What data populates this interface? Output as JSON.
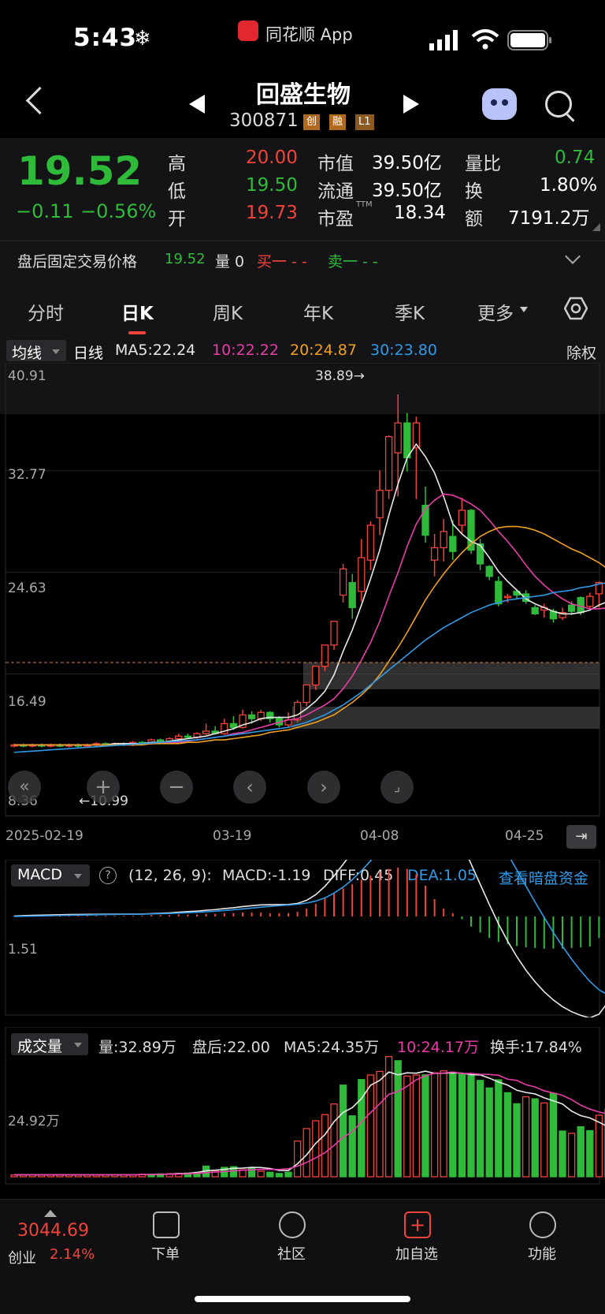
{
  "status_bar": {
    "time": "5:43",
    "app_name": "同花顺 App"
  },
  "header": {
    "stock_name": "回盛生物",
    "stock_code": "300871",
    "tags": [
      "创",
      "融",
      "L1"
    ]
  },
  "quote": {
    "price": "19.52",
    "change": "−0.11",
    "change_pct": "−0.56%",
    "high_label": "高",
    "high": "20.00",
    "low_label": "低",
    "low": "19.50",
    "open_label": "开",
    "open": "19.73",
    "mktcap_label": "市值",
    "mktcap": "39.50亿",
    "float_label": "流通",
    "float": "39.50亿",
    "pe_label": "市盈",
    "pe_sup": "TTM",
    "pe": "18.34",
    "vol_ratio_label": "量比",
    "vol_ratio": "0.74",
    "turnover_label": "换",
    "turnover": "1.80%",
    "amount_label": "额",
    "amount": "7191.2万"
  },
  "after_hours": {
    "label": "盘后固定交易价格",
    "price": "19.52",
    "vol": "量 0",
    "buy": "买一 - -",
    "sell": "卖一 - -"
  },
  "tabs": [
    "分时",
    "日K",
    "周K",
    "年K",
    "季K",
    "更多"
  ],
  "active_tab": "日K",
  "ma_bar": {
    "dropdown": "均线",
    "period": "日线",
    "ma5": "MA5:22.24",
    "ma10": "10:22.22",
    "ma20": "20:24.87",
    "ma30": "30:23.80",
    "fq": "除权"
  },
  "kline": {
    "y_ticks": [
      "40.91",
      "32.77",
      "24.63",
      "16.49",
      "8.36"
    ],
    "max_label": "38.89→",
    "min_label": "←10.99",
    "dates": [
      "2025-02-19",
      "03-19",
      "04-08",
      "04-25"
    ]
  },
  "macd": {
    "dropdown": "MACD",
    "params": "(12, 26, 9):",
    "macd": "MACD:-1.19",
    "diff": "DIFF:0.45",
    "dea": "DEA:1.05",
    "link": "查看暗盘资金",
    "tick": "1.51"
  },
  "volume": {
    "dropdown": "成交量",
    "vol": "量:32.89万",
    "after": "盘后:22.00",
    "ma5": "MA5:24.35万",
    "ma10": "10:24.17万",
    "turnover": "换手:17.84%",
    "tick": "24.92万"
  },
  "bottom": {
    "index_value": "3044.69",
    "index_name": "创业",
    "index_pct": "2.14%",
    "nav": [
      "下单",
      "社区",
      "加自选",
      "功能"
    ]
  },
  "colors": {
    "up": "#f0443a",
    "down": "#2fba3a",
    "ma5": "#e8e8e8",
    "ma10": "#e83ca8",
    "ma20": "#f0a020",
    "ma30": "#2f9ae8"
  },
  "chart_data": {
    "type": "candlestick",
    "ylim": [
      8.36,
      40.91
    ],
    "candles": [
      {
        "o": 10.7,
        "c": 10.8,
        "h": 10.9,
        "l": 10.6
      },
      {
        "o": 10.8,
        "c": 10.7,
        "h": 10.9,
        "l": 10.6
      },
      {
        "o": 10.7,
        "c": 10.8,
        "h": 10.9,
        "l": 10.6
      },
      {
        "o": 10.8,
        "c": 10.7,
        "h": 10.9,
        "l": 10.6
      },
      {
        "o": 10.7,
        "c": 10.8,
        "h": 10.9,
        "l": 10.6
      },
      {
        "o": 10.8,
        "c": 10.7,
        "h": 10.9,
        "l": 10.6
      },
      {
        "o": 10.7,
        "c": 10.8,
        "h": 10.9,
        "l": 10.6
      },
      {
        "o": 10.8,
        "c": 10.7,
        "h": 10.9,
        "l": 10.6
      },
      {
        "o": 10.7,
        "c": 10.8,
        "h": 10.9,
        "l": 10.6
      },
      {
        "o": 10.8,
        "c": 10.9,
        "h": 11.0,
        "l": 10.7
      },
      {
        "o": 10.9,
        "c": 10.8,
        "h": 11.0,
        "l": 10.7
      },
      {
        "o": 10.8,
        "c": 10.9,
        "h": 11.0,
        "l": 10.7
      },
      {
        "o": 10.9,
        "c": 10.8,
        "h": 11.0,
        "l": 10.7
      },
      {
        "o": 10.8,
        "c": 11.0,
        "h": 11.1,
        "l": 10.7
      },
      {
        "o": 11.0,
        "c": 10.9,
        "h": 11.1,
        "l": 10.8
      },
      {
        "o": 10.9,
        "c": 11.2,
        "h": 11.3,
        "l": 10.8
      },
      {
        "o": 11.2,
        "c": 11.0,
        "h": 11.3,
        "l": 10.9
      },
      {
        "o": 11.0,
        "c": 11.3,
        "h": 11.4,
        "l": 10.9
      },
      {
        "o": 11.3,
        "c": 11.5,
        "h": 11.7,
        "l": 11.2
      },
      {
        "o": 11.5,
        "c": 11.4,
        "h": 11.7,
        "l": 11.3
      },
      {
        "o": 11.4,
        "c": 11.7,
        "h": 11.8,
        "l": 11.3
      },
      {
        "o": 11.7,
        "c": 11.9,
        "h": 12.5,
        "l": 11.6
      },
      {
        "o": 11.9,
        "c": 11.7,
        "h": 12.3,
        "l": 11.6
      },
      {
        "o": 11.7,
        "c": 12.5,
        "h": 12.9,
        "l": 11.6
      },
      {
        "o": 12.5,
        "c": 12.2,
        "h": 13.1,
        "l": 12.0
      },
      {
        "o": 12.2,
        "c": 13.2,
        "h": 13.6,
        "l": 12.1
      },
      {
        "o": 13.2,
        "c": 12.9,
        "h": 13.5,
        "l": 12.5
      },
      {
        "o": 12.9,
        "c": 13.4,
        "h": 13.6,
        "l": 12.7
      },
      {
        "o": 13.4,
        "c": 12.9,
        "h": 13.5,
        "l": 12.6
      },
      {
        "o": 12.9,
        "c": 12.4,
        "h": 13.1,
        "l": 12.2
      },
      {
        "o": 12.4,
        "c": 12.8,
        "h": 13.4,
        "l": 12.2
      },
      {
        "o": 12.8,
        "c": 14.2,
        "h": 14.4,
        "l": 12.6
      },
      {
        "o": 14.2,
        "c": 15.6,
        "h": 15.6,
        "l": 13.9
      },
      {
        "o": 15.6,
        "c": 17.1,
        "h": 17.1,
        "l": 15.2
      },
      {
        "o": 17.1,
        "c": 18.8,
        "h": 18.8,
        "l": 16.7
      },
      {
        "o": 18.8,
        "c": 20.7,
        "h": 20.7,
        "l": 18.4
      },
      {
        "o": 22.8,
        "c": 24.9,
        "h": 25.3,
        "l": 22.2
      },
      {
        "o": 23.8,
        "c": 21.8,
        "h": 24.5,
        "l": 20.9
      },
      {
        "o": 23.1,
        "c": 25.8,
        "h": 27.3,
        "l": 22.3
      },
      {
        "o": 25.6,
        "c": 28.4,
        "h": 28.7,
        "l": 24.8
      },
      {
        "o": 29.0,
        "c": 31.2,
        "h": 32.8,
        "l": 27.6
      },
      {
        "o": 31.2,
        "c": 35.5,
        "h": 35.6,
        "l": 30.5
      },
      {
        "o": 34.2,
        "c": 36.6,
        "h": 38.89,
        "l": 30.7
      },
      {
        "o": 36.6,
        "c": 33.8,
        "h": 37.4,
        "l": 32.7
      },
      {
        "o": 34.6,
        "c": 36.6,
        "h": 37.1,
        "l": 30.5
      },
      {
        "o": 30.0,
        "c": 27.6,
        "h": 31.5,
        "l": 27.0
      },
      {
        "o": 25.6,
        "c": 26.6,
        "h": 27.7,
        "l": 24.3
      },
      {
        "o": 26.6,
        "c": 27.9,
        "h": 28.9,
        "l": 25.5
      },
      {
        "o": 27.5,
        "c": 26.3,
        "h": 28.8,
        "l": 25.6
      },
      {
        "o": 28.4,
        "c": 29.6,
        "h": 30.6,
        "l": 27.7
      },
      {
        "o": 29.6,
        "c": 26.4,
        "h": 29.7,
        "l": 26.1
      },
      {
        "o": 26.9,
        "c": 25.3,
        "h": 27.3,
        "l": 24.8
      },
      {
        "o": 25.1,
        "c": 24.3,
        "h": 25.2,
        "l": 24.0
      },
      {
        "o": 23.9,
        "c": 22.1,
        "h": 24.3,
        "l": 21.9
      },
      {
        "o": 22.6,
        "c": 22.7,
        "h": 22.9,
        "l": 22.2
      },
      {
        "o": 23.1,
        "c": 22.8,
        "h": 23.3,
        "l": 22.5
      },
      {
        "o": 22.9,
        "c": 22.3,
        "h": 23.2,
        "l": 22.1
      },
      {
        "o": 21.8,
        "c": 21.3,
        "h": 22.0,
        "l": 21.2
      },
      {
        "o": 21.6,
        "c": 21.8,
        "h": 22.1,
        "l": 21.0
      },
      {
        "o": 21.5,
        "c": 20.9,
        "h": 21.7,
        "l": 20.6
      },
      {
        "o": 21.0,
        "c": 21.4,
        "h": 21.8,
        "l": 20.8
      },
      {
        "o": 22.0,
        "c": 21.5,
        "h": 22.3,
        "l": 21.2
      },
      {
        "o": 22.6,
        "c": 21.4,
        "h": 22.7,
        "l": 21.2
      },
      {
        "o": 21.9,
        "c": 22.7,
        "h": 23.0,
        "l": 21.7
      },
      {
        "o": 22.9,
        "c": 23.8,
        "h": 23.9,
        "l": 21.8
      }
    ],
    "ma5": [
      10.8,
      10.8,
      10.8,
      10.8,
      10.8,
      10.8,
      10.8,
      10.8,
      10.8,
      10.8,
      10.8,
      10.9,
      10.9,
      10.9,
      10.9,
      11.0,
      11.0,
      11.1,
      11.2,
      11.3,
      11.4,
      11.5,
      11.7,
      11.9,
      12.1,
      12.4,
      12.6,
      12.9,
      13.0,
      13.0,
      13.0,
      13.2,
      13.7,
      14.3,
      15.1,
      16.4,
      18.3,
      20.0,
      22.0,
      24.1,
      26.4,
      29.2,
      31.7,
      33.8,
      34.9,
      33.9,
      32.6,
      30.7,
      28.5,
      27.7,
      27.1,
      26.8,
      25.8,
      24.7,
      23.9,
      23.2,
      22.5,
      22.1,
      21.8,
      21.5,
      21.3,
      21.3,
      21.4,
      21.6,
      22.0,
      22.3
    ],
    "ma10": [
      10.8,
      10.8,
      10.8,
      10.8,
      10.8,
      10.8,
      10.8,
      10.8,
      10.8,
      10.8,
      10.8,
      10.8,
      10.8,
      10.8,
      10.9,
      10.9,
      10.9,
      11.0,
      11.0,
      11.1,
      11.2,
      11.3,
      11.4,
      11.5,
      11.7,
      11.8,
      12.0,
      12.2,
      12.4,
      12.6,
      12.8,
      12.9,
      13.2,
      13.6,
      14.0,
      14.5,
      15.3,
      16.3,
      17.6,
      19.0,
      20.7,
      22.7,
      24.6,
      26.7,
      28.5,
      29.7,
      30.4,
      30.9,
      30.8,
      30.5,
      30.1,
      29.6,
      28.8,
      27.9,
      27.1,
      26.2,
      25.2,
      24.3,
      23.6,
      23.0,
      22.5,
      22.1,
      21.9,
      21.7,
      21.7,
      21.8
    ],
    "ma20": [
      10.8,
      10.8,
      10.8,
      10.8,
      10.8,
      10.8,
      10.8,
      10.8,
      10.8,
      10.8,
      10.8,
      10.8,
      10.8,
      10.8,
      10.8,
      10.9,
      10.9,
      10.9,
      10.9,
      11.0,
      11.0,
      11.1,
      11.2,
      11.2,
      11.3,
      11.4,
      11.5,
      11.6,
      11.8,
      11.9,
      12.0,
      12.2,
      12.4,
      12.6,
      12.9,
      13.2,
      13.7,
      14.2,
      14.8,
      15.5,
      16.4,
      17.5,
      18.6,
      19.8,
      21.1,
      22.4,
      23.5,
      24.5,
      25.4,
      26.2,
      26.9,
      27.5,
      27.9,
      28.2,
      28.3,
      28.3,
      28.2,
      28.0,
      27.7,
      27.3,
      26.9,
      26.5,
      26.2,
      25.8,
      25.4,
      24.87
    ],
    "ma30": [
      10.2,
      10.25,
      10.3,
      10.35,
      10.4,
      10.45,
      10.5,
      10.55,
      10.6,
      10.65,
      10.7,
      10.75,
      10.8,
      10.85,
      10.9,
      10.95,
      11.0,
      11.05,
      11.1,
      11.15,
      11.2,
      11.3,
      11.4,
      11.5,
      11.6,
      11.7,
      11.8,
      11.9,
      12.0,
      12.1,
      12.2,
      12.4,
      12.6,
      12.9,
      13.2,
      13.6,
      14.0,
      14.5,
      15.0,
      15.6,
      16.2,
      16.8,
      17.4,
      18.0,
      18.6,
      19.2,
      19.7,
      20.2,
      20.6,
      21.0,
      21.4,
      21.7,
      22.0,
      22.2,
      22.4,
      22.5,
      22.6,
      22.7,
      22.8,
      23.0,
      23.1,
      23.2,
      23.4,
      23.5,
      23.7,
      23.8
    ],
    "macd_hist": [
      0.1,
      0.1,
      0.1,
      0.1,
      0.1,
      0.1,
      0.1,
      0.1,
      0.1,
      0.1,
      0.1,
      0.1,
      0.1,
      0.1,
      0.1,
      0.2,
      0.2,
      0.2,
      0.3,
      0.3,
      0.3,
      0.4,
      0.4,
      0.5,
      0.5,
      0.6,
      0.6,
      0.6,
      0.5,
      0.5,
      0.5,
      0.7,
      1.2,
      1.9,
      2.7,
      3.5,
      4.2,
      4.8,
      5.5,
      6.1,
      6.7,
      7.1,
      7.3,
      7.1,
      6.3,
      4.6,
      2.6,
      1.2,
      0.5,
      -0.4,
      -1.5,
      -2.4,
      -3.2,
      -3.8,
      -4.1,
      -4.4,
      -4.6,
      -4.7,
      -4.8,
      -4.8,
      -4.8,
      -4.7,
      -4.6,
      -4.5,
      -3.2,
      -1.19
    ],
    "volume": [
      0.9,
      0.9,
      0.9,
      0.9,
      0.9,
      0.9,
      0.9,
      0.9,
      0.9,
      0.9,
      1.0,
      1.0,
      1.0,
      1.0,
      1.2,
      1.2,
      1.4,
      1.5,
      1.6,
      1.8,
      2.2,
      5.2,
      3.0,
      4.6,
      4.9,
      3.4,
      4.1,
      2.7,
      2.2,
      1.6,
      2.2,
      17.4,
      23.5,
      27.3,
      30.3,
      35.5,
      44.7,
      29.7,
      47.4,
      49.6,
      51.4,
      58.6,
      56.6,
      49.1,
      49.6,
      49.7,
      50.7,
      51.7,
      51.0,
      50.0,
      49.3,
      47.0,
      43.3,
      47.3,
      41.0,
      35.6,
      39.0,
      38.0,
      36.0,
      40.7,
      22.3,
      21.2,
      24.4,
      22.5,
      30.0,
      32.89
    ],
    "vol_up": [
      true,
      true,
      true,
      true,
      true,
      true,
      true,
      true,
      true,
      true,
      true,
      true,
      true,
      true,
      true,
      false,
      false,
      true,
      true,
      false,
      false,
      false,
      true,
      false,
      false,
      true,
      false,
      true,
      false,
      false,
      false,
      true,
      true,
      true,
      true,
      true,
      false,
      false,
      false,
      true,
      true,
      true,
      false,
      true,
      true,
      false,
      true,
      true,
      false,
      false,
      false,
      false,
      false,
      false,
      false,
      false,
      true,
      false,
      true,
      false,
      false,
      true,
      false,
      false,
      true,
      true
    ],
    "vol_ma5": [
      1.0,
      1.0,
      1.0,
      1.0,
      1.0,
      1.0,
      1.0,
      1.0,
      1.0,
      1.0,
      1.0,
      1.0,
      1.0,
      1.0,
      1.1,
      1.1,
      1.2,
      1.3,
      1.5,
      1.6,
      2.1,
      2.9,
      3.2,
      3.6,
      4.1,
      4.2,
      4.6,
      4.5,
      4.0,
      3.1,
      3.0,
      6.3,
      10.7,
      16.3,
      20.5,
      26.8,
      31.4,
      33.7,
      38.1,
      44.6,
      47.0,
      51.1,
      49.7,
      50.7,
      50.5,
      51.5,
      50.4,
      50.5,
      50.7,
      50.5,
      49.8,
      49.7,
      48.1,
      46.2,
      44.7,
      42.2,
      41.1,
      40.4,
      38.5,
      37.0,
      35.5,
      32.0,
      29.8,
      28.7,
      26.6,
      24.35
    ],
    "vol_ma10": [
      1.0,
      1.0,
      1.0,
      1.0,
      1.0,
      1.0,
      1.0,
      1.0,
      1.0,
      1.0,
      1.0,
      1.0,
      1.0,
      1.0,
      1.1,
      1.1,
      1.2,
      1.2,
      1.3,
      1.4,
      1.7,
      2.0,
      2.3,
      2.6,
      2.9,
      3.2,
      3.4,
      3.6,
      3.6,
      3.6,
      3.9,
      5.2,
      7.0,
      9.2,
      11.7,
      15.3,
      19.2,
      22.0,
      26.7,
      31.3,
      35.6,
      40.2,
      41.6,
      44.1,
      47.3,
      49.2,
      50.5,
      50.6,
      51.1,
      50.3,
      50.4,
      50.0,
      49.9,
      49.5,
      47.6,
      47.0,
      44.9,
      43.8,
      41.9,
      40.9,
      39.7,
      37.6,
      34.9,
      33.0,
      31.6,
      30.5
    ]
  }
}
